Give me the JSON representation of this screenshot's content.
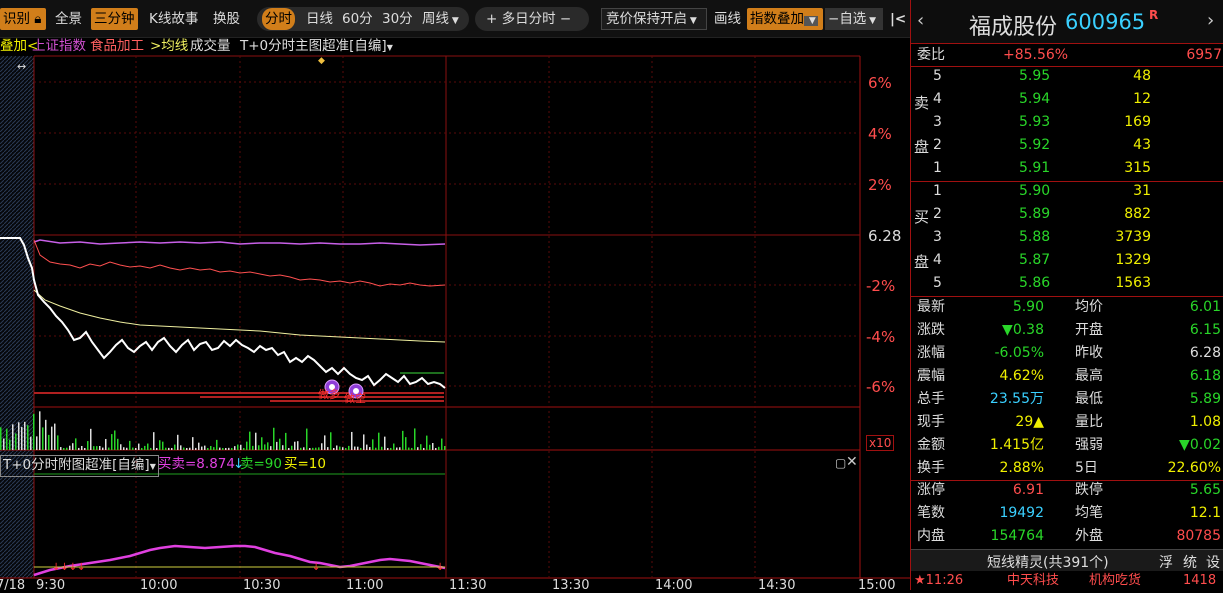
{
  "toolbar": {
    "recognize": "识别",
    "fullview": "全景",
    "three_min": "三分钟",
    "kline_story": "K线故事",
    "switch_stock": "换股",
    "fenshi": "分时",
    "day": "日线",
    "min60": "60分",
    "min30": "30分",
    "week": "周线",
    "multi_day": "多日分时",
    "auction": "竞价保持开启",
    "draw": "画线",
    "index_overlay": "指数叠加",
    "watchlist": "自选",
    "collapse": "|<"
  },
  "legend": {
    "overlay_prefix": "叠加<",
    "shanghai": "上证指数",
    "food": "食品加工",
    "avg": ">均线",
    "volume": "成交量",
    "main_indicator": "T+0分时主图超准[自编]"
  },
  "chart": {
    "right_axis": [
      "6%",
      "4%",
      "2%",
      "6.28",
      "-2%",
      "-4%",
      "-6%"
    ],
    "vol_scale": "x10",
    "sub_title": "T+0分时附图超准[自编]",
    "sub_buy_sell": "买卖=8.874",
    "sub_sell": "卖=90",
    "sub_buy": "买=10",
    "times": [
      "9:30",
      "10:00",
      "10:30",
      "11:00",
      "11:30",
      "13:30",
      "14:00",
      "14:30",
      "15:00"
    ],
    "left_date": "7/18",
    "marker_text1": "做多",
    "marker_text2": "做空"
  },
  "quote": {
    "name": "福成股份",
    "code": "600965",
    "flag": "R",
    "weibi_label": "委比",
    "weibi_value": "+85.56%",
    "weicha_value": "6957",
    "sell_label_top": "卖",
    "sell_label_bot": "盘",
    "buy_label_top": "买",
    "buy_label_bot": "盘",
    "asks": [
      {
        "lvl": "5",
        "price": "5.95",
        "vol": "48"
      },
      {
        "lvl": "4",
        "price": "5.94",
        "vol": "12"
      },
      {
        "lvl": "3",
        "price": "5.93",
        "vol": "169"
      },
      {
        "lvl": "2",
        "price": "5.92",
        "vol": "43"
      },
      {
        "lvl": "1",
        "price": "5.91",
        "vol": "315"
      }
    ],
    "bids": [
      {
        "lvl": "1",
        "price": "5.90",
        "vol": "31"
      },
      {
        "lvl": "2",
        "price": "5.89",
        "vol": "882"
      },
      {
        "lvl": "3",
        "price": "5.88",
        "vol": "3739"
      },
      {
        "lvl": "4",
        "price": "5.87",
        "vol": "1329"
      },
      {
        "lvl": "5",
        "price": "5.86",
        "vol": "1563"
      }
    ],
    "stats": [
      {
        "l1": "最新",
        "v1": "5.90",
        "c1": "grn",
        "l2": "均价",
        "v2": "6.01",
        "c2": "grn"
      },
      {
        "l1": "涨跌",
        "v1": "▼0.38",
        "c1": "grn",
        "l2": "开盘",
        "v2": "6.15",
        "c2": "grn"
      },
      {
        "l1": "涨幅",
        "v1": "-6.05%",
        "c1": "grn",
        "l2": "昨收",
        "v2": "6.28",
        "c2": "wht"
      },
      {
        "l1": "震幅",
        "v1": "4.62%",
        "c1": "yel",
        "l2": "最高",
        "v2": "6.18",
        "c2": "grn"
      },
      {
        "l1": "总手",
        "v1": "23.55万",
        "c1": "cyan",
        "l2": "最低",
        "v2": "5.89",
        "c2": "grn"
      },
      {
        "l1": "现手",
        "v1": "29▲",
        "c1": "yel",
        "l2": "量比",
        "v2": "1.08",
        "c2": "yel"
      },
      {
        "l1": "金额",
        "v1": "1.415亿",
        "c1": "yel",
        "l2": "强弱",
        "v2": "▼0.02",
        "c2": "grn"
      },
      {
        "l1": "换手",
        "v1": "2.88%",
        "c1": "yel",
        "l2": "5日",
        "v2": "22.60%",
        "c2": "yel"
      }
    ],
    "limits": [
      {
        "l1": "涨停",
        "v1": "6.91",
        "c1": "red",
        "l2": "跌停",
        "v2": "5.65",
        "c2": "grn"
      },
      {
        "l1": "笔数",
        "v1": "19492",
        "c1": "cyan",
        "l2": "均笔",
        "v2": "12.1",
        "c2": "yel"
      },
      {
        "l1": "内盘",
        "v1": "154764",
        "c1": "grn",
        "l2": "外盘",
        "v2": "80785",
        "c2": "red"
      }
    ],
    "sprite_title": "短线精灵(共391个)",
    "sprite_tabs": [
      "浮",
      "统",
      "设"
    ],
    "bottom_time": "★11:26",
    "bottom_name": "中天科技",
    "bottom_event": "机构吃货",
    "bottom_vol": "1418"
  },
  "colors": {
    "accent": "#d17e1a",
    "up": "#ff4d4d",
    "down": "#29d629",
    "grid": "#8a0f0f"
  }
}
